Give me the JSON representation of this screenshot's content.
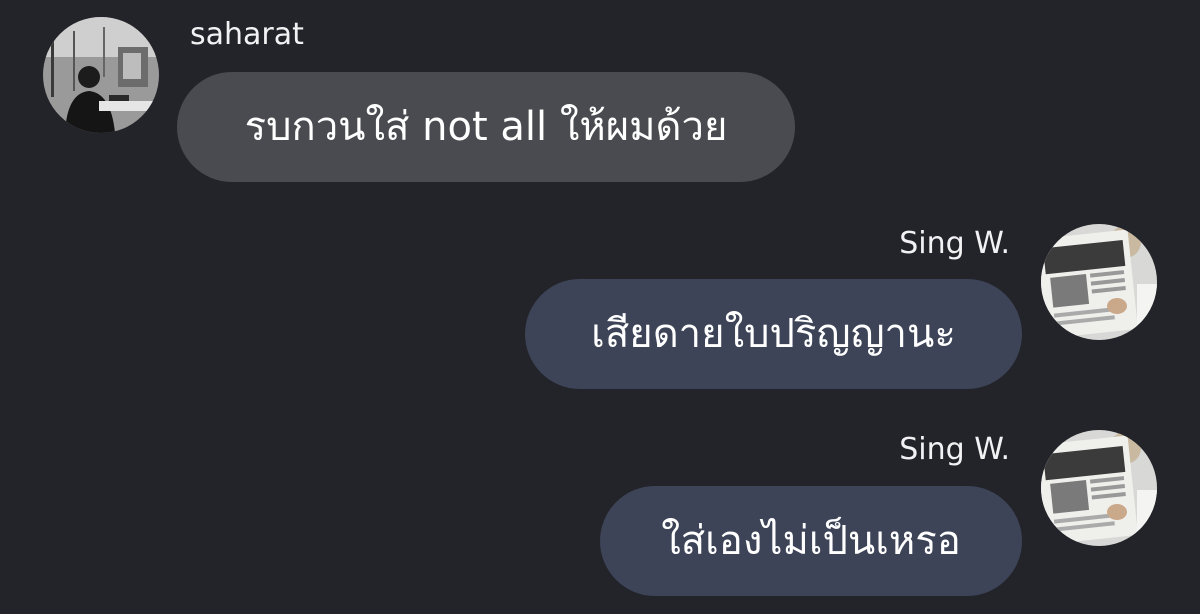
{
  "colors": {
    "background": "#232429",
    "incoming_bubble": "#4a4b50",
    "outgoing_bubble": "#3d4458",
    "text": "#ffffff"
  },
  "messages": [
    {
      "sender": "saharat",
      "direction": "incoming",
      "avatar_icon": "user-photo-avatar",
      "text": "รบกวนใส่ not all ให้ผมด้วย"
    },
    {
      "sender": "Sing W.",
      "direction": "outgoing",
      "avatar_icon": "newspaper-photo-avatar",
      "text": "เสียดายใบปริญญานะ"
    },
    {
      "sender": "Sing W.",
      "direction": "outgoing",
      "avatar_icon": "newspaper-photo-avatar",
      "text": "ใส่เองไม่เป็นเหรอ"
    }
  ]
}
